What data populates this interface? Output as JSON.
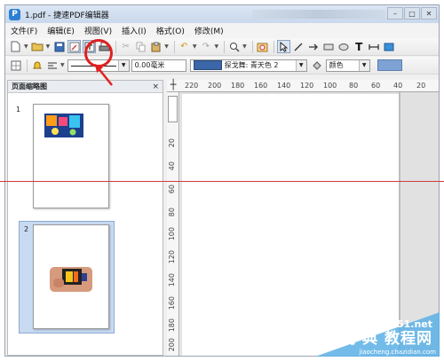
{
  "window": {
    "logo_glyph": "P",
    "title": "1.pdf - 捷速PDF编辑器",
    "min_label": "–",
    "max_label": "□",
    "close_label": "✕"
  },
  "menu": {
    "items": [
      "文件(F)",
      "编辑(E)",
      "视图(V)",
      "插入(I)",
      "格式(O)",
      "修改(M)"
    ]
  },
  "toolbar2": {
    "width_value": "0.00毫米",
    "fill_label": "探戈舞: 青天色 2",
    "color_label": "颜色",
    "fill_color": "#3b67a8",
    "accent_color": "#7ea2d4"
  },
  "panel": {
    "title": "页面缩略图",
    "close_label": "×",
    "pages": [
      {
        "number": "1"
      },
      {
        "number": "2"
      }
    ]
  },
  "ruler": {
    "corner": "┼",
    "h_ticks": [
      "220",
      "200",
      "180",
      "160",
      "140",
      "120",
      "100",
      "80",
      "60",
      "40",
      "20"
    ],
    "v_ticks": [
      "20",
      "40",
      "60",
      "80",
      "100",
      "120",
      "140",
      "160",
      "180",
      "200"
    ]
  },
  "watermark": {
    "site": "jb51.net",
    "cn": "查字典 教程网",
    "url": "jiaocheng.chazidian.com"
  },
  "annotation": {
    "color": "#e02020"
  }
}
